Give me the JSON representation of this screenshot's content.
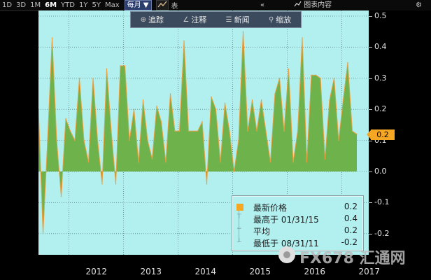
{
  "toolbar": {
    "ranges": [
      "1D",
      "3D",
      "1M",
      "6M",
      "YTD",
      "1Y",
      "5Y",
      "Max"
    ],
    "active_range": "6M",
    "frequency": "每月 ▼",
    "chart_type_label": "表",
    "collapse_icon": "double-chevron-left",
    "chart_content_label": "图表内容",
    "settings_icon": "gear"
  },
  "plot_tools": {
    "track": "追踪",
    "annotate": "注释",
    "news": "新闻",
    "zoom": "缩放"
  },
  "last_value_tag": "0.2",
  "legend": {
    "latest_label": "最新价格",
    "latest_value": "0.2",
    "high_label": "最高于 01/31/15",
    "high_value": "0.4",
    "avg_label": "平均",
    "avg_value": "0.2",
    "low_label": "最低于 08/31/11",
    "low_value": "-0.2",
    "colors": {
      "latest": "#f5a623",
      "area": "#6db24a"
    }
  },
  "watermark": "FX678 汇通网",
  "chart_data": {
    "type": "area",
    "ylim": [
      -0.25,
      0.5
    ],
    "yticks": [
      "0.5",
      "0.4",
      "0.3",
      "0.2",
      "0.1",
      "0.0",
      "-0.1",
      "-0.2"
    ],
    "xticks": [
      "2012",
      "2013",
      "2014",
      "2015",
      "2016",
      "2017"
    ],
    "x": [
      "2011-04",
      "2011-05",
      "2011-06",
      "2011-07",
      "2011-08",
      "2011-09",
      "2011-10",
      "2011-11",
      "2011-12",
      "2012-01",
      "2012-02",
      "2012-03",
      "2012-04",
      "2012-05",
      "2012-06",
      "2012-07",
      "2012-08",
      "2012-09",
      "2012-10",
      "2012-11",
      "2012-12",
      "2013-01",
      "2013-02",
      "2013-03",
      "2013-04",
      "2013-05",
      "2013-06",
      "2013-07",
      "2013-08",
      "2013-09",
      "2013-10",
      "2013-11",
      "2013-12",
      "2014-01",
      "2014-02",
      "2014-03",
      "2014-04",
      "2014-05",
      "2014-06",
      "2014-07",
      "2014-08",
      "2014-09",
      "2014-10",
      "2014-11",
      "2014-12",
      "2015-01",
      "2015-02",
      "2015-03",
      "2015-04",
      "2015-05",
      "2015-06",
      "2015-07",
      "2015-08",
      "2015-09",
      "2015-10",
      "2015-11",
      "2015-12",
      "2016-01",
      "2016-02",
      "2016-03",
      "2016-04",
      "2016-05",
      "2016-06",
      "2016-07",
      "2016-08",
      "2016-09",
      "2016-10",
      "2016-11",
      "2016-12",
      "2017-01",
      "2017-02"
    ],
    "values": [
      0.2,
      -0.2,
      0.1,
      0.43,
      0.1,
      -0.08,
      0.17,
      0.13,
      0.1,
      0.3,
      0.1,
      0.03,
      0.3,
      0.1,
      -0.04,
      0.33,
      0.13,
      -0.04,
      0.34,
      0.34,
      0.1,
      0.2,
      0.03,
      0.23,
      0.1,
      0.04,
      0.21,
      0.16,
      0.03,
      0.25,
      0.13,
      0.13,
      0.42,
      0.13,
      0.13,
      0.13,
      0.16,
      -0.04,
      0.24,
      0.2,
      0.03,
      0.22,
      0.13,
      0.0,
      0.1,
      0.45,
      0.13,
      0.23,
      0.13,
      0.23,
      0.13,
      0.03,
      0.25,
      0.3,
      0.13,
      0.33,
      0.03,
      0.13,
      0.43,
      0.03,
      0.31,
      0.31,
      0.3,
      0.04,
      0.23,
      0.3,
      0.1,
      0.23,
      0.35,
      0.13,
      0.12
    ]
  }
}
